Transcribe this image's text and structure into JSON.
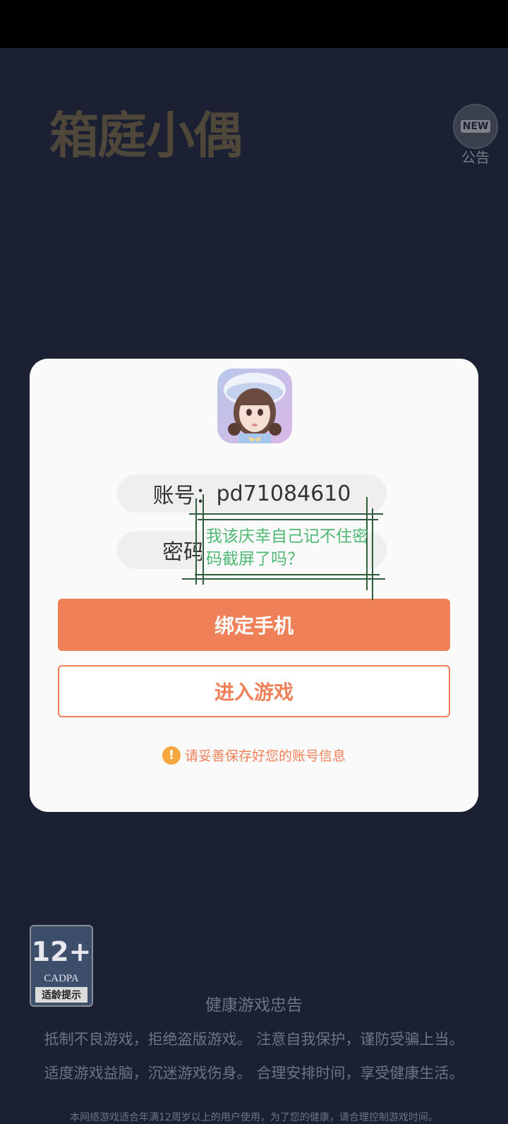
{
  "logo": {
    "text": "箱庭小偶"
  },
  "notice": {
    "badge": "NEW",
    "label": "公告"
  },
  "dialog": {
    "account_label": "账号：",
    "account_value": "pd71084610",
    "password_label": "密码",
    "bind_button": "绑定手机",
    "enter_button": "进入游戏",
    "tip": "请妥善保存好您的账号信息",
    "tip_icon": "!"
  },
  "annotation": {
    "text": "我该庆幸自己记不住密码截屏了吗？"
  },
  "age_rating": {
    "number": "12+",
    "org": "CADPA",
    "tip": "适龄提示"
  },
  "health": {
    "title": "健康游戏忠告",
    "line1": "抵制不良游戏，拒绝盗版游戏。 注意自我保护，谨防受骗上当。",
    "line2": "适度游戏益脑，沉迷游戏伤身。 合理安排时间，享受健康生活。",
    "notice": "本网络游戏适合年满12周岁以上的用户使用，为了您的健康，请合理控制游戏时间。"
  },
  "colors": {
    "accent": "#f08058",
    "background": "#1b2033",
    "annotation": "#4fb872"
  }
}
